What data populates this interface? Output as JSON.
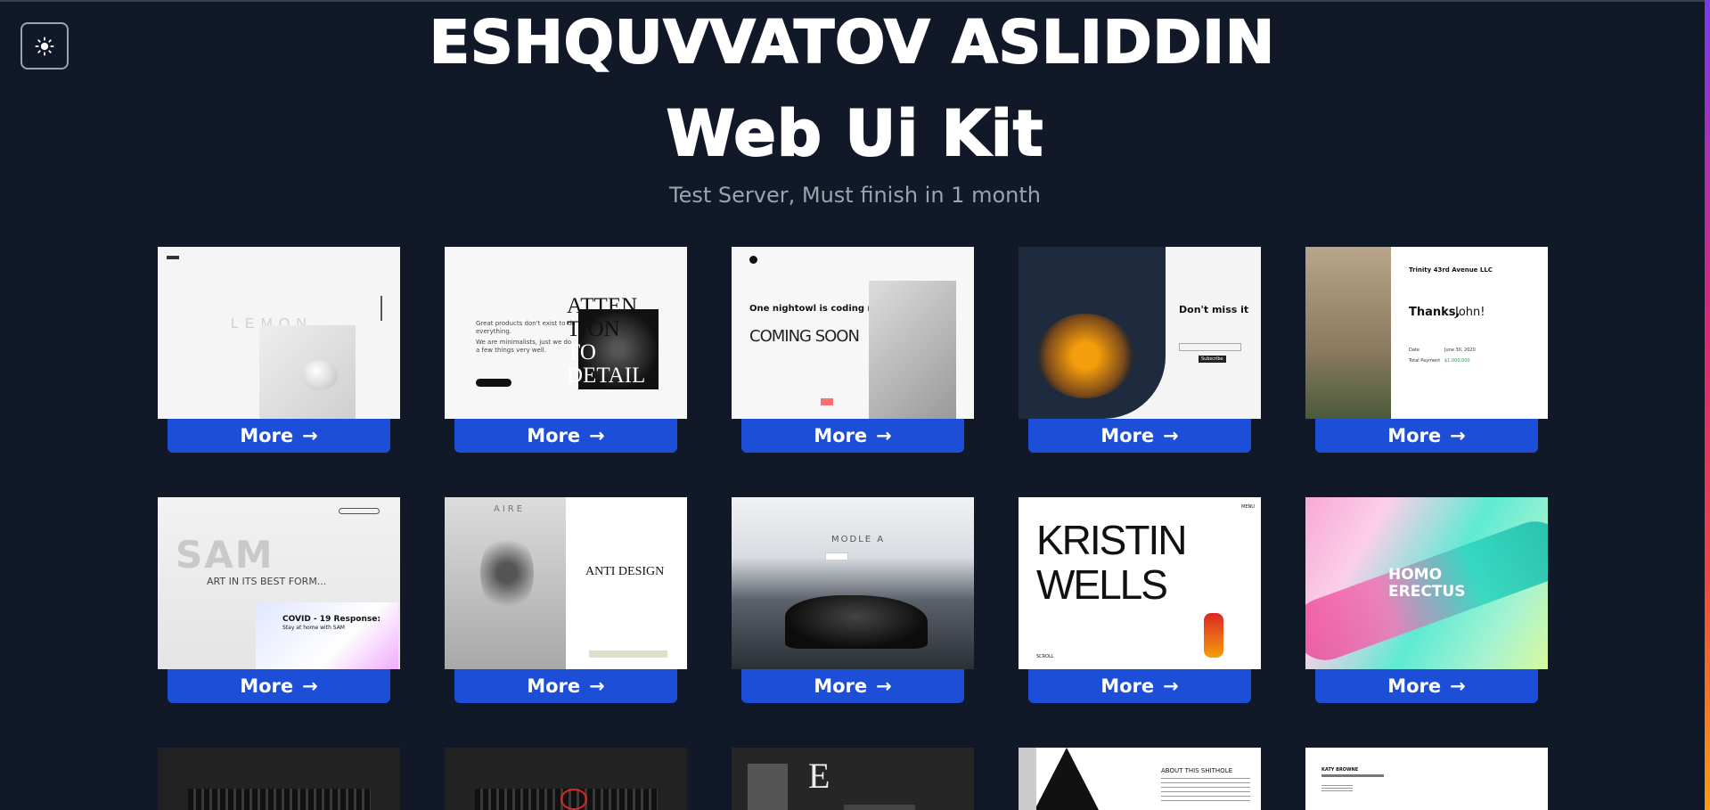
{
  "header": {
    "title": "ESHQUVVATOV ASLIDDIN",
    "subtitle_title": "Web Ui Kit",
    "tagline": "Test Server, Must finish in 1 month"
  },
  "theme_toggle": {
    "icon": "sun-icon"
  },
  "more_label": "More",
  "cards": [
    {
      "name": "lemon",
      "texts": {
        "word": "LEMON"
      }
    },
    {
      "name": "attention",
      "texts": {
        "line1": "Great products don't exist to do",
        "line2": "everything.",
        "line3": "We are minimalists, just we do",
        "line4": "a few things very well.",
        "big1": "ATTEN",
        "big2": "TION",
        "big3": "TO",
        "big4": "DETAIL"
      }
    },
    {
      "name": "coming-soon",
      "texts": {
        "line1": "One nightowl is coding really hard",
        "big": "COMING SOON"
      }
    },
    {
      "name": "dont-miss",
      "texts": {
        "title": "Don't miss it",
        "button": "Subscribe"
      }
    },
    {
      "name": "trinity",
      "texts": {
        "company": "Trinity 43rd Avenue LLC",
        "thanks": "Thanks,",
        "name": "John!",
        "date_label": "Date",
        "date_value": "June 30, 2020",
        "total_label": "Total Payment",
        "total_value": "$1,000,000"
      }
    },
    {
      "name": "sam",
      "texts": {
        "big": "SAM",
        "line": "ART IN ITS BEST FORM...",
        "covid": "COVID - 19 Response:",
        "covid_sub": "Stay at home with SAM"
      }
    },
    {
      "name": "anti-design",
      "texts": {
        "logo": "AIRE",
        "title": "ANTI DESIGN"
      }
    },
    {
      "name": "model-a",
      "texts": {
        "title": "MODLE A"
      }
    },
    {
      "name": "kristin",
      "texts": {
        "line1": "KRISTIN",
        "line2": "WELLS",
        "menu": "MENU",
        "foot": "SCROLL"
      }
    },
    {
      "name": "homo-erectus",
      "texts": {
        "line1": "HOMO",
        "line2": "ERECTUS"
      }
    },
    {
      "name": "dark-1",
      "texts": {}
    },
    {
      "name": "dark-2",
      "texts": {}
    },
    {
      "name": "dark-e",
      "texts": {
        "letter": "E"
      }
    },
    {
      "name": "about",
      "texts": {
        "title": "ABOUT THIS SHITHOLE"
      }
    },
    {
      "name": "katy",
      "texts": {
        "name": "KATY BROWNE"
      }
    }
  ]
}
